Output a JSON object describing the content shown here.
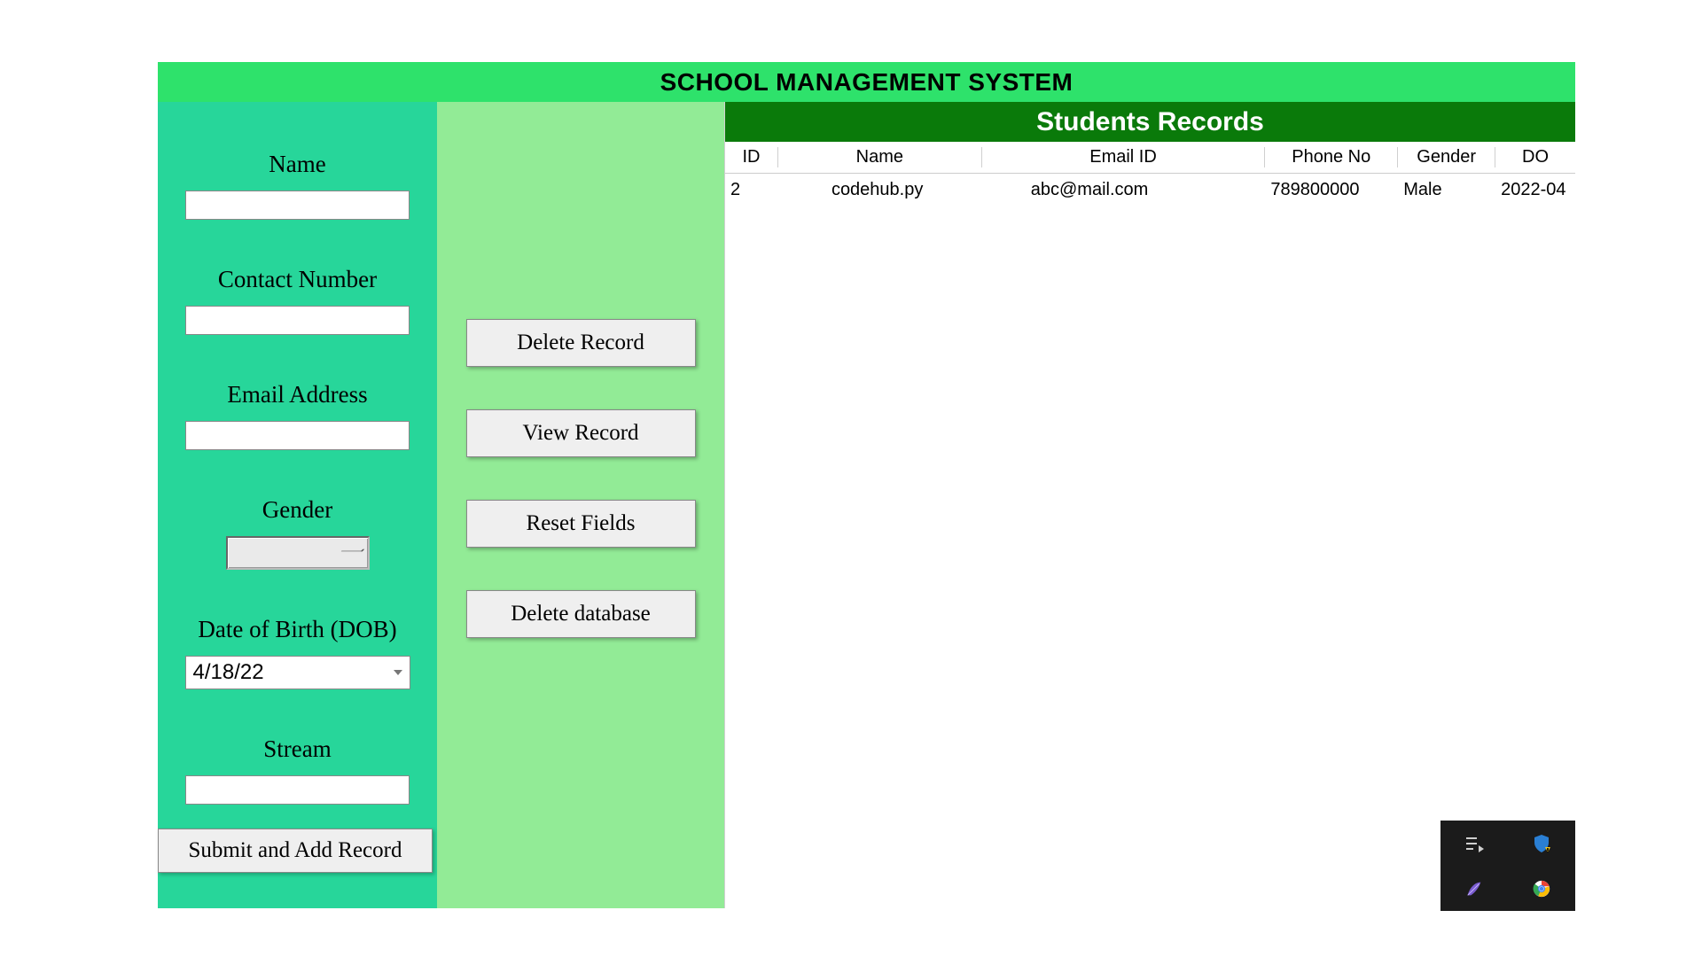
{
  "title": "SCHOOL MANAGEMENT SYSTEM",
  "form": {
    "name_label": "Name",
    "name_value": "",
    "contact_label": "Contact Number",
    "contact_value": "",
    "email_label": "Email Address",
    "email_value": "",
    "gender_label": "Gender",
    "gender_value": "",
    "dob_label": "Date of Birth (DOB)",
    "dob_value": "4/18/22",
    "stream_label": "Stream",
    "stream_value": "",
    "submit_label": "Submit and Add Record"
  },
  "actions": {
    "delete_record": "Delete Record",
    "view_record": "View Record",
    "reset_fields": "Reset Fields",
    "delete_database": "Delete database"
  },
  "records": {
    "title": "Students Records",
    "columns": [
      "ID",
      "Name",
      "Email ID",
      "Phone No",
      "Gender",
      "DO"
    ],
    "rows": [
      {
        "id": "2",
        "name": "codehub.py",
        "email": "abc@mail.com",
        "phone": "789800000",
        "gender": "Male",
        "dob": "2022-04"
      }
    ]
  }
}
